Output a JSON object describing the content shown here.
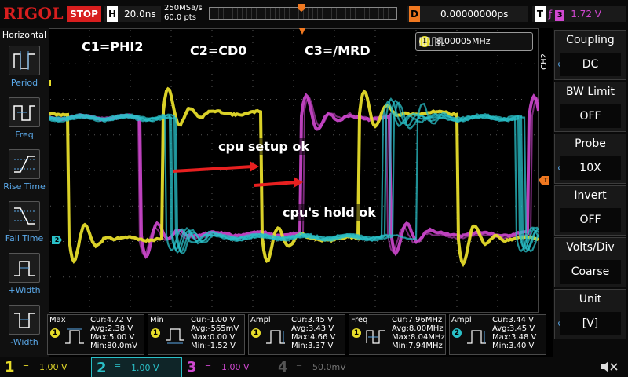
{
  "topbar": {
    "brand": "RIGOL",
    "run_state": "STOP",
    "horizontal_label": "H",
    "timebase": "20.0ns",
    "sample_rate": "250MSa/s",
    "memory_points": "60.0 pts",
    "delay_label": "D",
    "delay_value": "0.00000000ps",
    "trigger_label": "T",
    "trigger_symbol": "ƒ",
    "trigger_channel": "3",
    "trigger_level": "1.72 V"
  },
  "left_panel": {
    "title": "Horizontal",
    "items": [
      {
        "label": "Period",
        "icon": "period-icon"
      },
      {
        "label": "Freq",
        "icon": "freq-icon"
      },
      {
        "label": "Rise Time",
        "icon": "rise-time-icon"
      },
      {
        "label": "Fall Time",
        "icon": "fall-time-icon"
      },
      {
        "label": "+Width",
        "icon": "positive-width-icon"
      },
      {
        "label": "-Width",
        "icon": "negative-width-icon"
      }
    ]
  },
  "right_panel": {
    "channel_label": "CH2",
    "buttons": [
      {
        "title": "Coupling",
        "value": "DC",
        "knob": true
      },
      {
        "title": "BW Limit",
        "value": "OFF",
        "knob": false
      },
      {
        "title": "Probe",
        "value": "10X",
        "knob": true
      },
      {
        "title": "Invert",
        "value": "OFF",
        "knob": false
      },
      {
        "title": "Volts/Div",
        "value": "Coarse",
        "knob": false
      },
      {
        "title": "Unit",
        "value": "[V]",
        "knob": true
      }
    ]
  },
  "screen": {
    "freq_counter_channel": "1",
    "freq_counter_value": "8.00005MHz",
    "ch2_marker": "2",
    "trigger_marker": "T",
    "annotations": {
      "c1": "C1=PHI2",
      "c2": "C2=CD0",
      "c3": "C3=/MRD",
      "setup": "cpu setup ok",
      "hold": "cpu's hold ok"
    },
    "colors": {
      "ch1": "#e6dc2a",
      "ch2": "#2ac0c8",
      "ch3": "#d048d0",
      "ch4": "#3060d0",
      "arrow": "#e82020",
      "trigger": "#f07820"
    }
  },
  "measurements": [
    {
      "type": "Max",
      "channel": "1",
      "cur": "Cur:4.72 V",
      "avg": "Avg:2.38 V",
      "max": "Max:5.00 V",
      "min": "Min:80.0mV"
    },
    {
      "type": "Min",
      "channel": "1",
      "cur": "Cur:-1.00 V",
      "avg": "Avg:-565mV",
      "max": "Max:0.00 V",
      "min": "Min:-1.52 V"
    },
    {
      "type": "Ampl",
      "channel": "1",
      "cur": "Cur:3.45 V",
      "avg": "Avg:3.43 V",
      "max": "Max:4.66 V",
      "min": "Min:3.37 V"
    },
    {
      "type": "Freq",
      "channel": "1",
      "cur": "Cur:7.96MHz",
      "avg": "Avg:8.00MHz",
      "max": "Max:8.04MHz",
      "min": "Min:7.94MHz"
    },
    {
      "type": "Ampl",
      "channel": "2",
      "cur": "Cur:3.44 V",
      "avg": "Avg:3.45 V",
      "max": "Max:3.48 V",
      "min": "Min:3.40 V"
    }
  ],
  "bottombar": {
    "channels": [
      {
        "num": "1",
        "coupling": "═",
        "scale": "1.00 V",
        "color": "#e6dc2a"
      },
      {
        "num": "2",
        "coupling": "═",
        "scale": "1.00 V",
        "color": "#2ac0c8"
      },
      {
        "num": "3",
        "coupling": "═",
        "scale": "1.00 V",
        "color": "#d048d0"
      },
      {
        "num": "4",
        "coupling": "═",
        "scale": "50.0mV",
        "color": "#555555"
      }
    ]
  }
}
